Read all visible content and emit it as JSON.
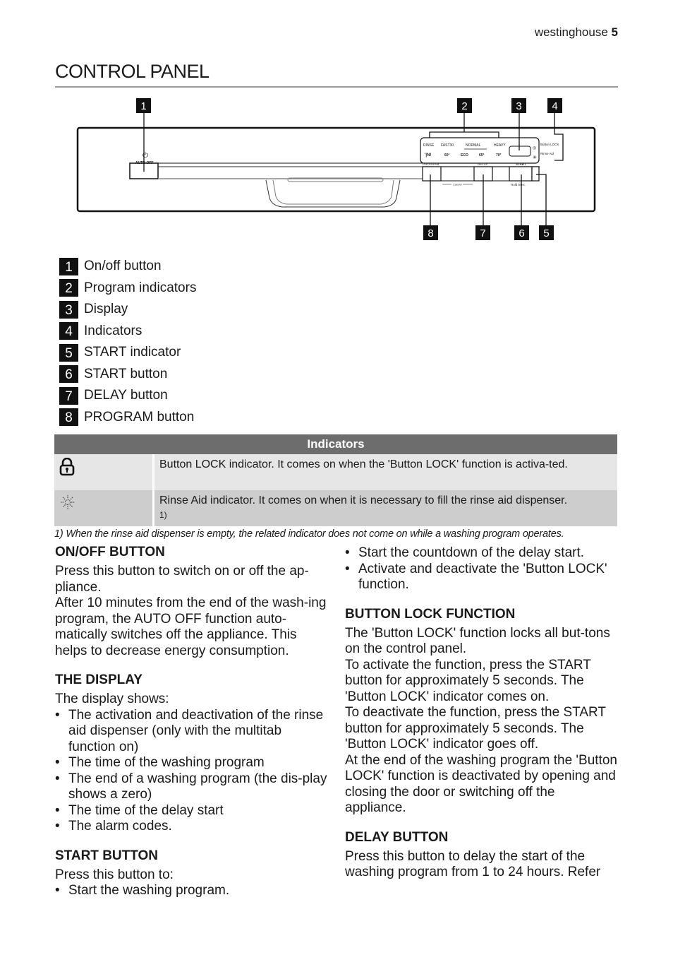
{
  "header": {
    "brand": "westinghouse",
    "page_number": "5"
  },
  "title": "CONTROL PANEL",
  "diagram": {
    "callouts": [
      "1",
      "2",
      "3",
      "4",
      "5",
      "6",
      "7",
      "8"
    ],
    "panel_labels": {
      "auto_off": "AUTO OFF",
      "rinse": "RINSE",
      "fast30": "FAST30",
      "normal": "NORMAL",
      "heavy": "HEAVY",
      "fast30_temp": "60°",
      "eco": "ECO",
      "normal_temp": "65°",
      "heavy_temp": "70°",
      "button_lock": "Button LOCK",
      "rinse_aid": "Rinse Aid",
      "program": "PROGRAM",
      "delay": "DELAY",
      "start": "START",
      "cancel": "Cancel",
      "hold": "Hold 5sec."
    }
  },
  "legend": [
    {
      "num": "1",
      "label": "On/off button"
    },
    {
      "num": "2",
      "label": "Program indicators"
    },
    {
      "num": "3",
      "label": "Display"
    },
    {
      "num": "4",
      "label": "Indicators"
    },
    {
      "num": "5",
      "label": "START indicator"
    },
    {
      "num": "6",
      "label": "START button"
    },
    {
      "num": "7",
      "label": "DELAY button"
    },
    {
      "num": "8",
      "label": "PROGRAM button"
    }
  ],
  "indicators_table": {
    "header": "Indicators",
    "rows": [
      {
        "icon": "lock-icon",
        "text": "Button LOCK indicator. It comes on when the 'Button LOCK' function is activa-ted.",
        "note": ""
      },
      {
        "icon": "rinse-aid-icon",
        "text": "Rinse Aid indicator. It comes on when it is necessary to fill the rinse aid dispenser.",
        "note": "1)"
      }
    ],
    "footnote": "1) When the rinse aid dispenser is empty, the related indicator does not come on while a washing program operates."
  },
  "sections": {
    "onoff": {
      "heading": "ON/OFF BUTTON",
      "p1": "Press this button to switch on or off the ap-pliance.",
      "p2": "After 10 minutes from the end of the wash-ing program, the AUTO OFF function auto-matically switches off the appliance. This helps to decrease energy consumption."
    },
    "display": {
      "heading": "THE DISPLAY",
      "intro": "The display shows:",
      "items": [
        "The activation and deactivation of the rinse aid dispenser (only with the multitab function on)",
        "The time of the washing program",
        "The end of a washing program (the dis-play shows a zero)",
        "The time of the delay start",
        "The alarm codes."
      ]
    },
    "start": {
      "heading": "START BUTTON",
      "intro": "Press this button to:",
      "items": [
        "Start the washing program.",
        "Start the countdown of the delay start.",
        "Activate and deactivate the 'Button LOCK' function."
      ]
    },
    "lock": {
      "heading": "BUTTON LOCK FUNCTION",
      "p1": "The 'Button LOCK' function locks all but-tons on the control panel.",
      "p2": "To activate the function, press the START button for approximately 5 seconds. The 'Button LOCK' indicator comes on.",
      "p3": "To deactivate the function, press the START button for approximately 5 seconds. The 'Button LOCK' indicator goes off.",
      "p4": "At the end of the washing program the 'Button LOCK' function is deactivated by opening and closing the door or switching off the appliance."
    },
    "delay": {
      "heading": "DELAY BUTTON",
      "p1": "Press this button to delay the start of the washing program from 1 to 24 hours. Refer"
    }
  }
}
